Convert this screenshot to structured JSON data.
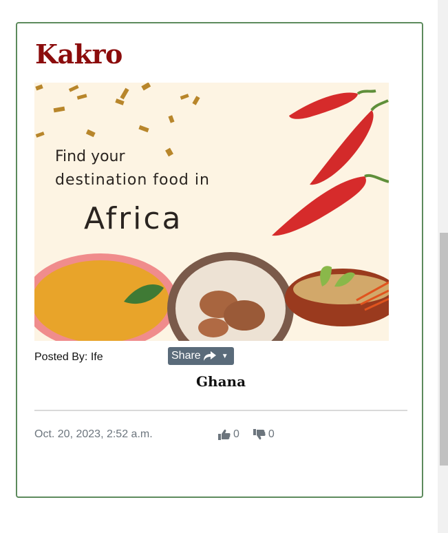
{
  "post": {
    "title": "Kakro",
    "image": {
      "line1": "Find your",
      "line2": "destination food in",
      "line3": "Africa",
      "background_color": "#fdf4e3",
      "accent_color": "#d62b2b"
    },
    "posted_by": "Posted By: Ife",
    "share_label": "Share",
    "country": "Ghana",
    "date": "Oct. 20, 2023, 2:52 a.m.",
    "likes": "0",
    "dislikes": "0"
  },
  "colors": {
    "title": "#8b0c0c",
    "card_border": "#5c8a5c",
    "share_button": "#5a6b7a",
    "muted_text": "#6c757d"
  },
  "icons": [
    "share-arrow-icon",
    "caret-down-icon",
    "thumbs-up-icon",
    "thumbs-down-icon"
  ]
}
